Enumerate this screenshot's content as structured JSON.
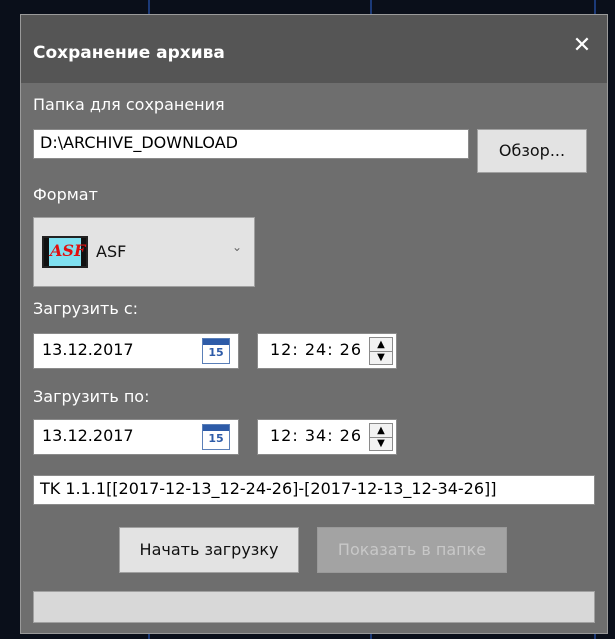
{
  "dialog": {
    "title": "Сохранение архива",
    "close_glyph": "✕"
  },
  "folder": {
    "label": "Папка для сохранения",
    "value": "D:\\ARCHIVE_DOWNLOAD",
    "browse_label": "Обзор..."
  },
  "format": {
    "label": "Формат",
    "icon_text": "ASF",
    "selected": "ASF",
    "chevron": "⌄"
  },
  "from": {
    "label": "Загрузить с:",
    "date": "13.12.2017",
    "calendar_day": "15",
    "time": "12: 24: 26"
  },
  "to": {
    "label": "Загрузить по:",
    "date": "13.12.2017",
    "calendar_day": "15",
    "time": "12: 34: 26"
  },
  "filename": {
    "value": "TK 1.1.1[[2017-12-13_12-24-26]-[2017-12-13_12-34-26]]"
  },
  "actions": {
    "start_label": "Начать загрузку",
    "show_label": "Показать в папке"
  },
  "spinner": {
    "up": "▲",
    "down": "▼"
  },
  "colors": {
    "dialog_bg": "#6e6e6e",
    "titlebar_bg": "#555555",
    "accent": "#2d5ba8"
  }
}
